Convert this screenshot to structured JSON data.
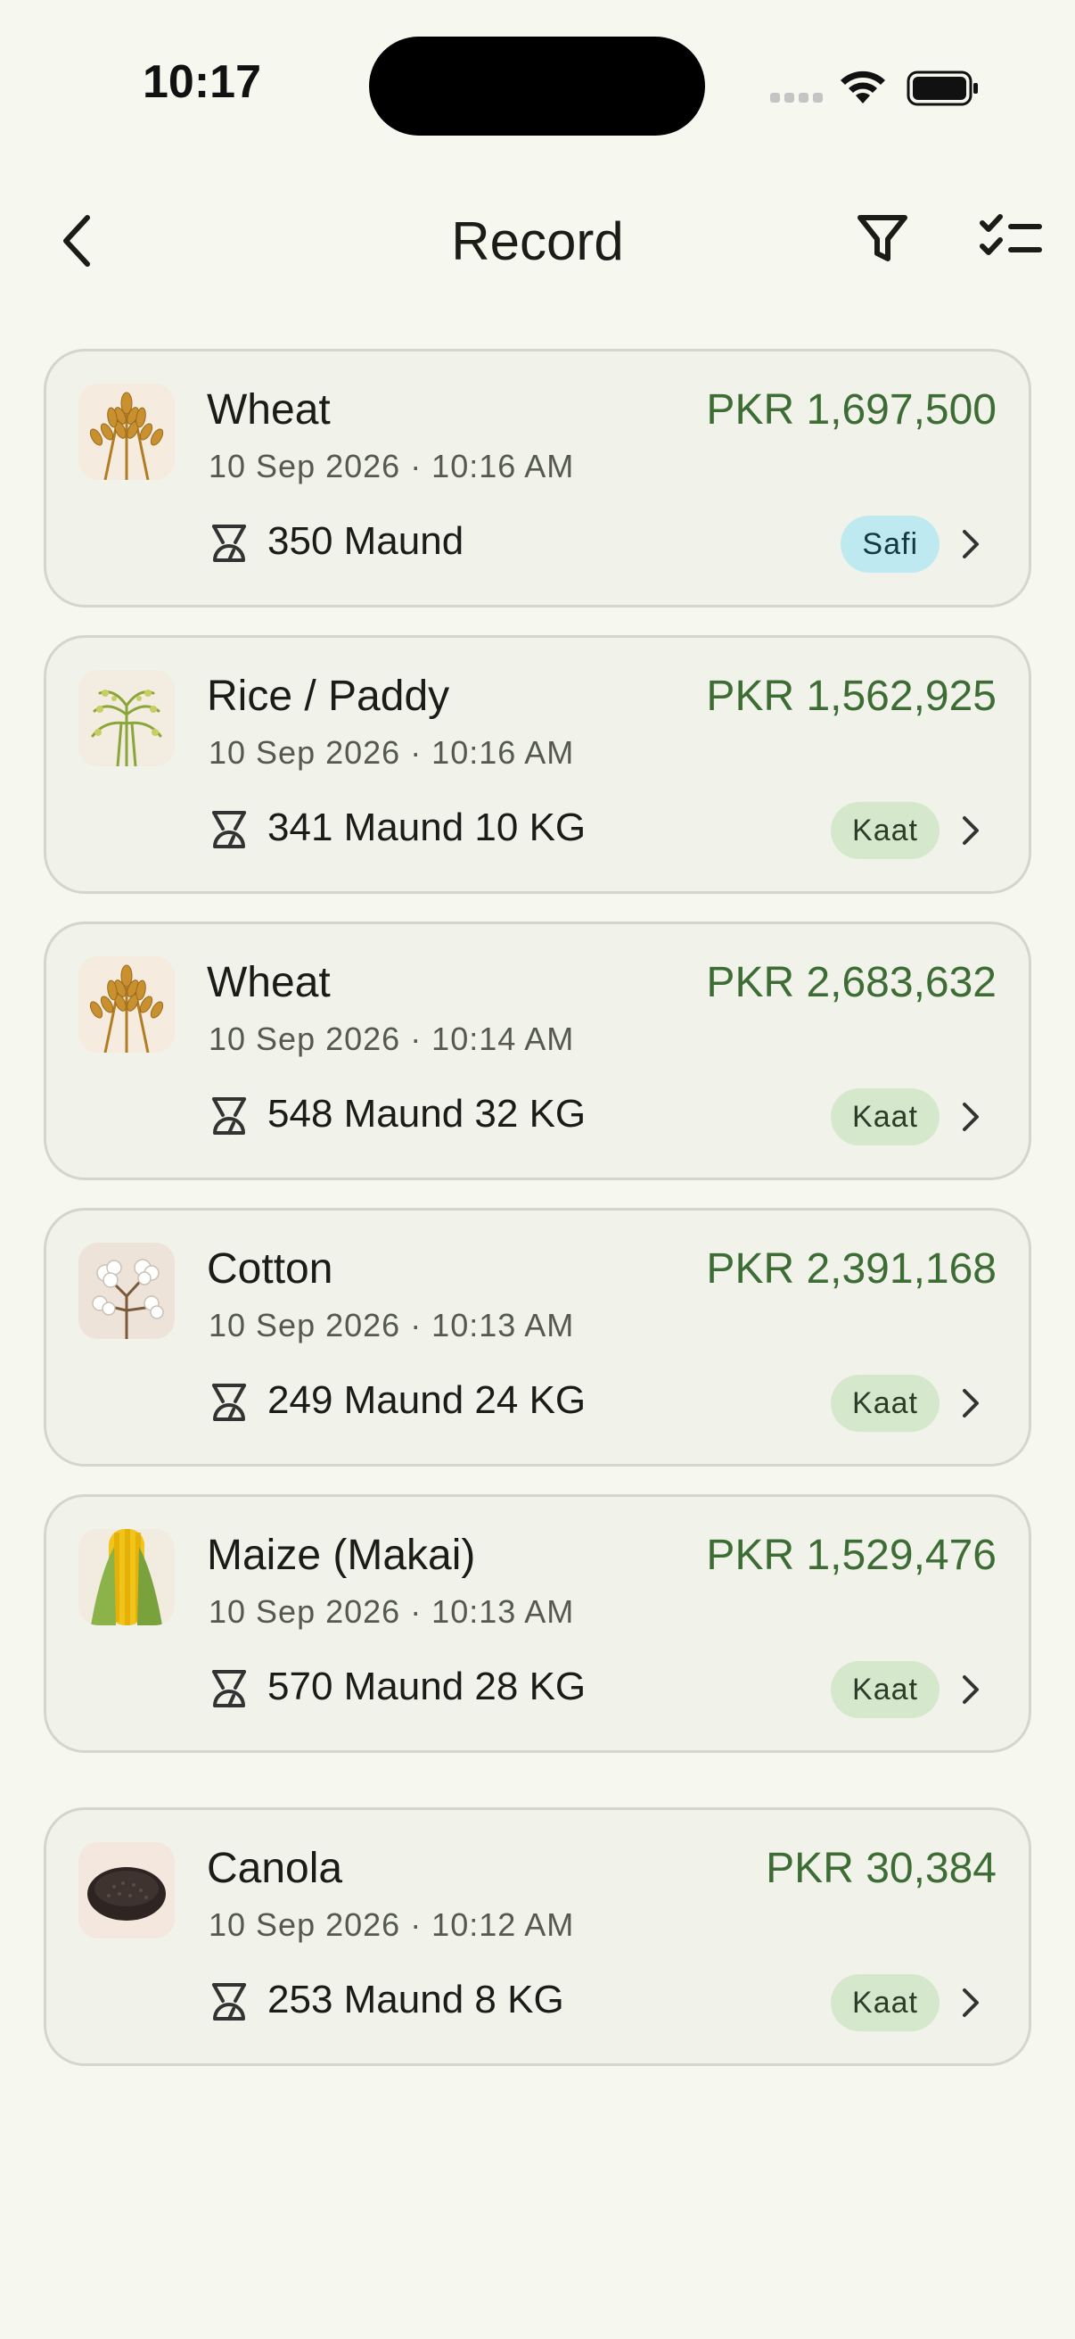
{
  "status_bar": {
    "time": "10:17"
  },
  "header": {
    "title": "Record"
  },
  "records": [
    {
      "name": "Wheat",
      "datetime": "10 Sep 2026 · 10:16 AM",
      "price": "PKR 1,697,500",
      "weight": "350 Maund",
      "badge": "Safi",
      "badge_type": "safi",
      "crop_icon": "wheat-icon"
    },
    {
      "name": "Rice / Paddy",
      "datetime": "10 Sep 2026 · 10:16 AM",
      "price": "PKR 1,562,925",
      "weight": "341 Maund 10 KG",
      "badge": "Kaat",
      "badge_type": "kaat",
      "crop_icon": "rice-icon"
    },
    {
      "name": "Wheat",
      "datetime": "10 Sep 2026 · 10:14 AM",
      "price": "PKR 2,683,632",
      "weight": "548 Maund 32 KG",
      "badge": "Kaat",
      "badge_type": "kaat",
      "crop_icon": "wheat-icon"
    },
    {
      "name": "Cotton",
      "datetime": "10 Sep 2026 · 10:13 AM",
      "price": "PKR 2,391,168",
      "weight": "249 Maund 24 KG",
      "badge": "Kaat",
      "badge_type": "kaat",
      "crop_icon": "cotton-icon"
    },
    {
      "name": "Maize (Makai)",
      "datetime": "10 Sep 2026 · 10:13 AM",
      "price": "PKR 1,529,476",
      "weight": "570 Maund 28 KG",
      "badge": "Kaat",
      "badge_type": "kaat",
      "crop_icon": "maize-icon"
    },
    {
      "name": "Canola",
      "datetime": "10 Sep 2026 · 10:12 AM",
      "price": "PKR 30,384",
      "weight": "253 Maund 8 KG",
      "badge": "Kaat",
      "badge_type": "kaat",
      "crop_icon": "canola-icon"
    }
  ],
  "colors": {
    "background": "#f6f8f0",
    "price": "#3d6d34",
    "safi_badge": "#bfe9f0",
    "kaat_badge": "#d5e8cc"
  }
}
